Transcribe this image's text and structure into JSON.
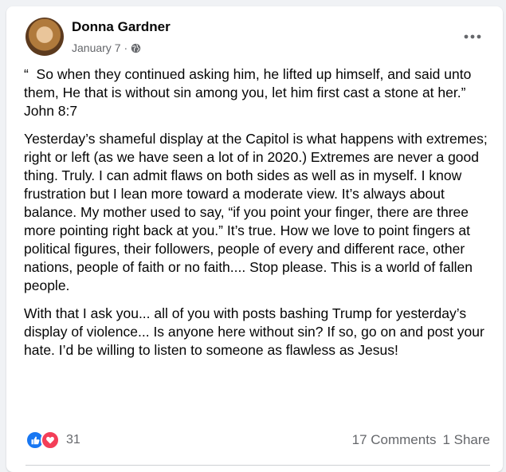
{
  "post": {
    "author": "Donna Gardner",
    "date": "January 7",
    "separator": "·",
    "privacy_icon": "globe-icon",
    "more_icon": "more-options-icon",
    "paragraphs": [
      "“  So when they continued asking him, he lifted up himself, and said unto them, He that is without sin among you, let him first cast a stone at her.”\nJohn 8:7",
      "Yesterday’s shameful display at the Capitol is what happens with extremes; right or left (as we have seen a lot of in 2020.) Extremes are never a good thing. Truly. I can admit flaws on both sides as well as in myself. I know frustration but I lean more toward a moderate view. It’s always about balance. My mother used to say, “if you point your finger, there are three more pointing right back at you.” It’s true. How we love to point fingers at political figures, their followers, people of every and different race, other nations, people of faith or no faith.... Stop please. This is a world of fallen people.",
      "With that I ask you... all of you with posts bashing Trump for yesterday’s display of violence... Is anyone here without sin? If so, go on and post your hate. I’d be willing to listen to someone as flawless as Jesus!"
    ]
  },
  "footer": {
    "reaction_icons": [
      "like-icon",
      "love-icon"
    ],
    "reaction_count": "31",
    "comments": "17 Comments",
    "shares": "1 Share"
  },
  "colors": {
    "like": "#1877f2",
    "love": "#f33e58",
    "secondary_text": "#65676b"
  }
}
